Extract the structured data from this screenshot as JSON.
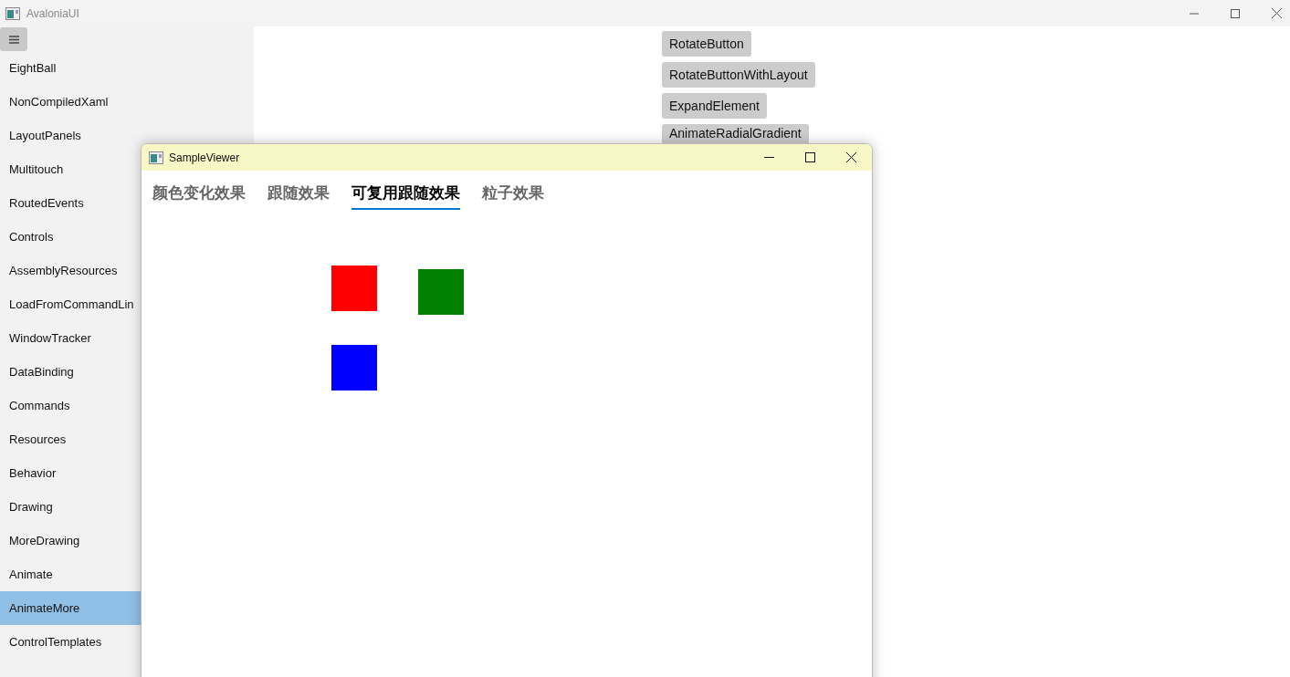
{
  "window": {
    "title": "AvaloniaUI"
  },
  "sidebar": {
    "items": [
      {
        "label": "EightBall",
        "selected": false
      },
      {
        "label": "NonCompiledXaml",
        "selected": false
      },
      {
        "label": "LayoutPanels",
        "selected": false
      },
      {
        "label": "Multitouch",
        "selected": false
      },
      {
        "label": "RoutedEvents",
        "selected": false
      },
      {
        "label": "Controls",
        "selected": false
      },
      {
        "label": "AssemblyResources",
        "selected": false
      },
      {
        "label": "LoadFromCommandLin",
        "selected": false
      },
      {
        "label": "WindowTracker",
        "selected": false
      },
      {
        "label": "DataBinding",
        "selected": false
      },
      {
        "label": "Commands",
        "selected": false
      },
      {
        "label": "Resources",
        "selected": false
      },
      {
        "label": "Behavior",
        "selected": false
      },
      {
        "label": "Drawing",
        "selected": false
      },
      {
        "label": "MoreDrawing",
        "selected": false
      },
      {
        "label": "Animate",
        "selected": false
      },
      {
        "label": "AnimateMore",
        "selected": true
      },
      {
        "label": "ControlTemplates",
        "selected": false
      }
    ]
  },
  "buttons": [
    "RotateButton",
    "RotateButtonWithLayout",
    "ExpandElement",
    "AnimateRadialGradient"
  ],
  "sample_viewer": {
    "title": "SampleViewer",
    "tabs": [
      {
        "label": "颜色变化效果",
        "selected": false
      },
      {
        "label": "跟随效果",
        "selected": false
      },
      {
        "label": "可复用跟随效果",
        "selected": true
      },
      {
        "label": "粒子效果",
        "selected": false
      }
    ],
    "squares": [
      {
        "color": "#ff0000"
      },
      {
        "color": "#008000"
      },
      {
        "color": "#0000ff"
      }
    ]
  }
}
